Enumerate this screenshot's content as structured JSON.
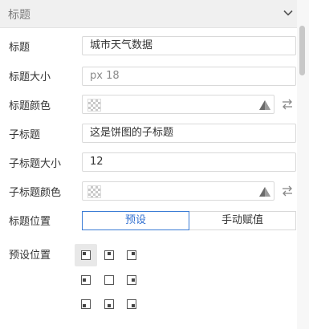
{
  "header": {
    "title": "标题",
    "collapse_icon": "chevron-down-icon"
  },
  "fields": {
    "title": {
      "label": "标题",
      "value": "城市天气数据"
    },
    "title_size": {
      "label": "标题大小",
      "placeholder": "px 18"
    },
    "title_color": {
      "label": "标题颜色",
      "value": "transparent"
    },
    "subtitle": {
      "label": "子标题",
      "value": "这是饼图的子标题"
    },
    "subtitle_size": {
      "label": "子标题大小",
      "value": "12"
    },
    "subtitle_color": {
      "label": "子标题颜色",
      "value": "transparent"
    }
  },
  "title_position": {
    "label": "标题位置",
    "options": [
      "预设",
      "手动赋值"
    ],
    "selected": "预设"
  },
  "preset_position": {
    "label": "预设位置",
    "selected": "top-left",
    "grid": [
      "top-left",
      "top-center",
      "top-right",
      "middle-left",
      "center",
      "middle-right",
      "bottom-left",
      "bottom-center",
      "bottom-right"
    ]
  },
  "colors": {
    "accent": "#3a7bd5",
    "header_bg": "#f0f0f0",
    "border": "#d9d9d9",
    "selected_cell_bg": "#e8e8e8"
  }
}
